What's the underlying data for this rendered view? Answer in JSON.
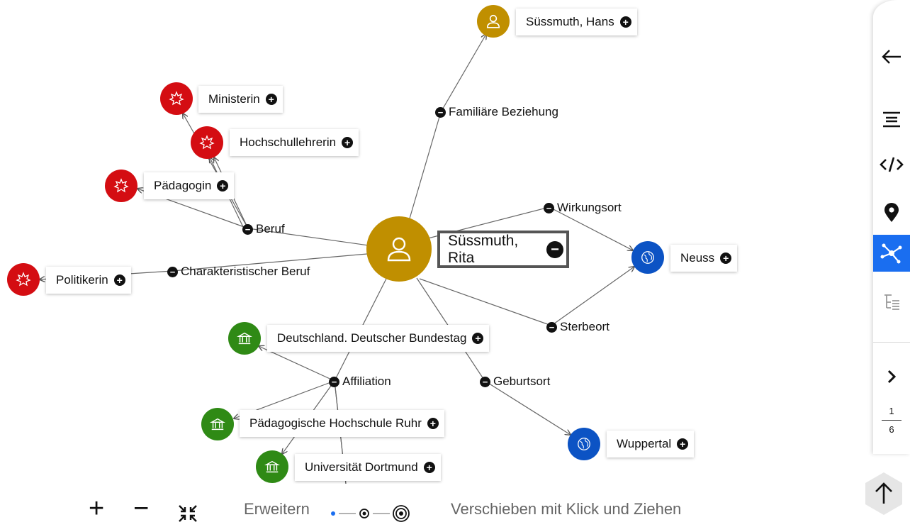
{
  "graph": {
    "center": {
      "name": "Süssmuth, Rita",
      "kind": "person"
    },
    "nodes": {
      "suessmuth_hans": {
        "name": "Süssmuth, Hans"
      },
      "ministerin": {
        "name": "Ministerin"
      },
      "hochschullehrerin": {
        "name": "Hochschullehrerin"
      },
      "paedagogin": {
        "name": "Pädagogin"
      },
      "politikerin": {
        "name": "Politikerin"
      },
      "neuss": {
        "name": "Neuss"
      },
      "bundestag": {
        "name": "Deutschland. Deutscher Bundestag"
      },
      "ph_ruhr": {
        "name": "Pädagogische Hochschule Ruhr"
      },
      "uni_dortmund": {
        "name": "Universität Dortmund"
      },
      "wuppertal": {
        "name": "Wuppertal"
      }
    },
    "relations": {
      "familiaere_beziehung": "Familiäre Beziehung",
      "beruf": "Beruf",
      "charakteristischer_beruf": "Charakteristischer Beruf",
      "wirkungsort": "Wirkungsort",
      "sterbeort": "Sterbeort",
      "affiliation": "Affiliation",
      "geburtsort": "Geburtsort"
    },
    "colors": {
      "person": "#c08f00",
      "occupation": "#d40d12",
      "place": "#0c53c4",
      "organisation": "#2f8a15",
      "accent": "#1a6ef0"
    }
  },
  "sidebar": {
    "buttons": [
      "back-arrow-icon",
      "list-icon",
      "code-icon",
      "location-pin-icon",
      "network-icon",
      "hierarchy-icon",
      "next-chevron-icon"
    ],
    "page_current": "1",
    "page_total": "6"
  },
  "toolbar": {
    "zoom_in": "+",
    "zoom_out": "−",
    "fit": "fit-to-screen-icon",
    "expand_label": "Erweitern",
    "pan_hint": "Verschieben mit Klick und Ziehen"
  }
}
